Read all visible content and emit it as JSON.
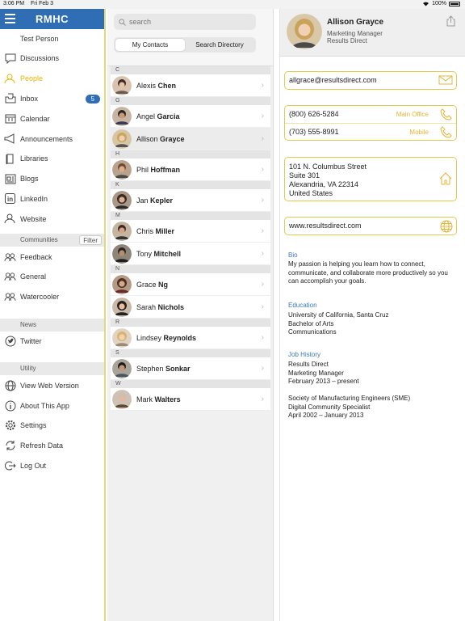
{
  "status": {
    "time": "3:06 PM",
    "date": "Fri Feb 3",
    "battery": "100%"
  },
  "sidebar": {
    "title": "RMHC",
    "user": "Test Person",
    "items": [
      {
        "label": "Discussions",
        "icon": "chat-icon"
      },
      {
        "label": "People",
        "icon": "people-icon",
        "active": true
      },
      {
        "label": "Inbox",
        "icon": "inbox-icon",
        "badge": "5"
      },
      {
        "label": "Calendar",
        "icon": "calendar-icon"
      },
      {
        "label": "Announcements",
        "icon": "megaphone-icon"
      },
      {
        "label": "Libraries",
        "icon": "book-icon"
      },
      {
        "label": "Blogs",
        "icon": "blog-icon"
      },
      {
        "label": "LinkedIn",
        "icon": "linkedin-icon"
      },
      {
        "label": "Website",
        "icon": "website-icon"
      }
    ],
    "communities_label": "Communities",
    "filter_label": "Filter",
    "communities": [
      {
        "label": "Feedback"
      },
      {
        "label": "General"
      },
      {
        "label": "Watercooler"
      }
    ],
    "news_label": "News",
    "news": [
      {
        "label": "Twitter"
      }
    ],
    "utility_label": "Utility",
    "utility": [
      {
        "label": "View Web Version"
      },
      {
        "label": "About This App"
      },
      {
        "label": "Settings"
      },
      {
        "label": "Refresh Data"
      },
      {
        "label": "Log Out"
      }
    ]
  },
  "contacts": {
    "search_placeholder": "search",
    "tab_my": "My Contacts",
    "tab_dir": "Search Directory",
    "groups": [
      {
        "letter": "C",
        "people": [
          {
            "first": "Alexis",
            "last": "Chen"
          }
        ]
      },
      {
        "letter": "G",
        "people": [
          {
            "first": "Angel",
            "last": "Garcia"
          },
          {
            "first": "Allison",
            "last": "Grayce",
            "selected": true
          }
        ]
      },
      {
        "letter": "H",
        "people": [
          {
            "first": "Phil",
            "last": "Hoffman"
          }
        ]
      },
      {
        "letter": "K",
        "people": [
          {
            "first": "Jan",
            "last": "Kepler"
          }
        ]
      },
      {
        "letter": "M",
        "people": [
          {
            "first": "Chris",
            "last": "Miller"
          },
          {
            "first": "Tony",
            "last": "Mitchell"
          }
        ]
      },
      {
        "letter": "N",
        "people": [
          {
            "first": "Grace",
            "last": "Ng"
          },
          {
            "first": "Sarah",
            "last": "Nichols"
          }
        ]
      },
      {
        "letter": "R",
        "people": [
          {
            "first": "Lindsey",
            "last": "Reynolds"
          }
        ]
      },
      {
        "letter": "S",
        "people": [
          {
            "first": "Stephen",
            "last": "Sonkar"
          }
        ]
      },
      {
        "letter": "W",
        "people": [
          {
            "first": "Mark",
            "last": "Walters"
          }
        ]
      }
    ]
  },
  "detail": {
    "name": "Allison Grayce",
    "title": "Marketing Manager",
    "company": "Results Direct",
    "email": "allgrace@resultsdirect.com",
    "phone1": "(800) 626-5284",
    "phone1_tag": "Main Office",
    "phone2": "(703) 555-8991",
    "phone2_tag": "Mobile",
    "address": [
      "101 N. Columbus Street",
      "Suite 301",
      "Alexandria, VA 22314",
      "United States"
    ],
    "website": "www.resultsdirect.com",
    "bio_title": "Bio",
    "bio": "My passion is helping you learn how to connect, communicate, and collaborate more productively so you can accomplish your goals.",
    "edu_title": "Education",
    "edu": [
      "University of California, Santa Cruz",
      "Bachelor of Arts",
      "Communications"
    ],
    "job_title": "Job History",
    "jobs": [
      "Results Direct",
      "Marketing Manager",
      "February 2013 – present",
      "",
      "Society of Manufacturing Engineers (SME)",
      "Digital Community Specialist",
      "April 2002 – January 2013"
    ]
  },
  "colors": {
    "brand": "#2f6db5",
    "accent": "#e8b400",
    "link": "#3b77bf"
  }
}
